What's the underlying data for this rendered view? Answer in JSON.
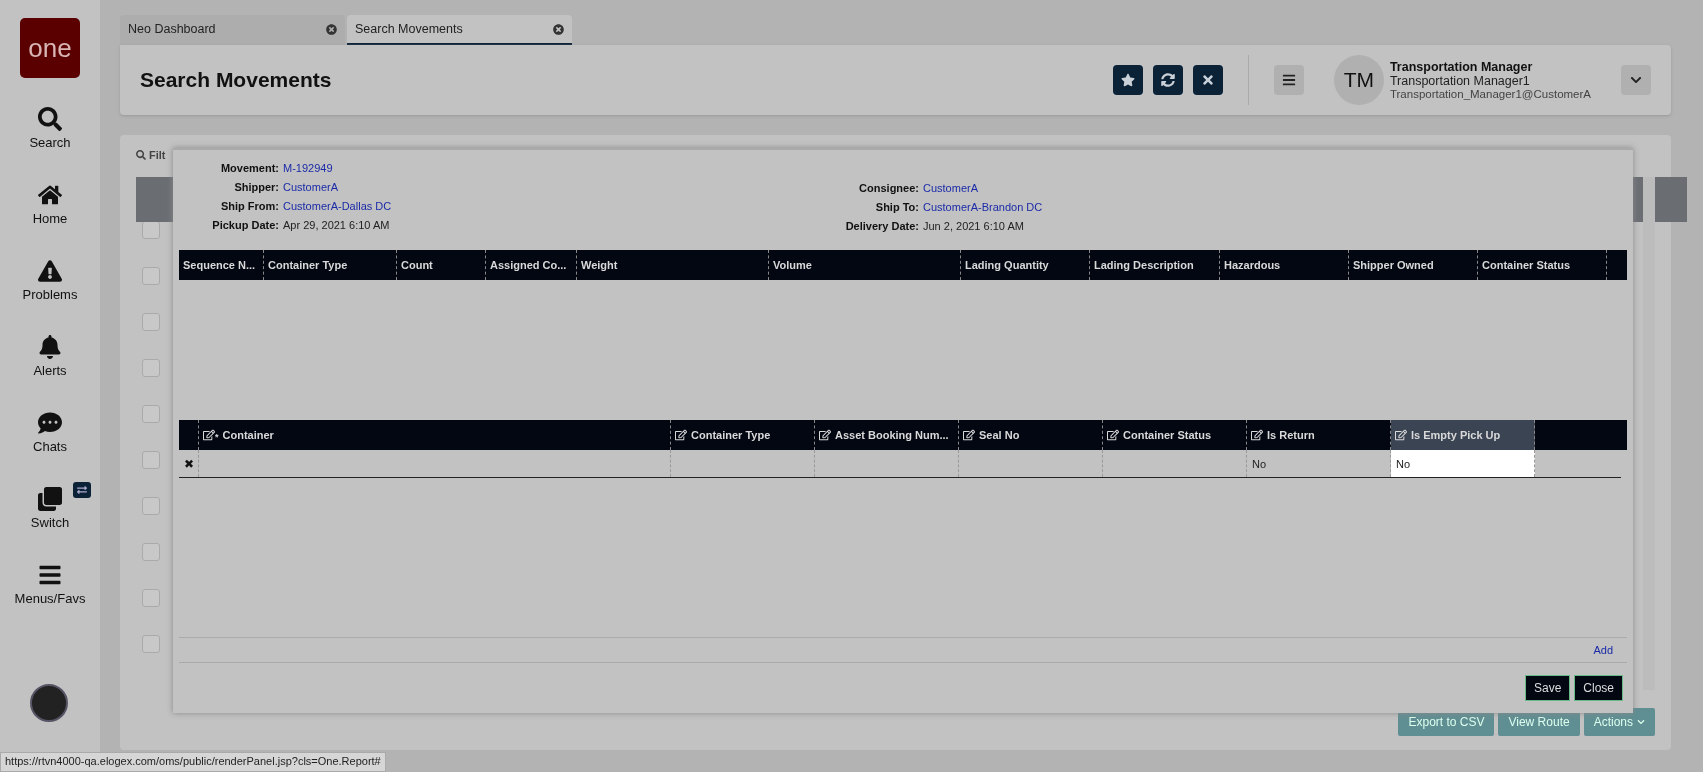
{
  "sidebar": {
    "logo": "one",
    "items": [
      {
        "label": "Search"
      },
      {
        "label": "Home"
      },
      {
        "label": "Problems"
      },
      {
        "label": "Alerts"
      },
      {
        "label": "Chats"
      },
      {
        "label": "Switch"
      },
      {
        "label": "Menus/Favs"
      }
    ]
  },
  "tabs": [
    {
      "label": "Neo Dashboard",
      "selected": false
    },
    {
      "label": "Search Movements",
      "selected": true
    }
  ],
  "header": {
    "title": "Search Movements",
    "user": {
      "initials": "TM",
      "name": "Transportation Manager",
      "role": "Transportation Manager1",
      "email": "Transportation_Manager1@CustomerA"
    }
  },
  "background": {
    "filter_label": "Filt",
    "rows": [
      {
        "checked": false
      },
      {
        "checked": false
      },
      {
        "checked": false
      },
      {
        "checked": false
      },
      {
        "checked": false
      },
      {
        "checked": false
      },
      {
        "checked": false
      },
      {
        "checked": false
      },
      {
        "checked": false
      },
      {
        "checked": false
      }
    ],
    "buttons": [
      "Export to CSV",
      "View Route",
      "Actions"
    ]
  },
  "modal": {
    "fields_left": [
      {
        "label": "Movement:",
        "value": "M-192949",
        "link": true
      },
      {
        "label": "Shipper:",
        "value": "CustomerA",
        "link": true
      },
      {
        "label": "Ship From:",
        "value": "CustomerA-Dallas DC",
        "link": true
      },
      {
        "label": "Pickup Date:",
        "value": "Apr 29, 2021 6:10 AM",
        "link": false
      }
    ],
    "fields_right": [
      {
        "label": "Consignee:",
        "value": "CustomerA",
        "link": true
      },
      {
        "label": "Ship To:",
        "value": "CustomerA-Brandon DC",
        "link": true
      },
      {
        "label": "Delivery Date:",
        "value": "Jun 2, 2021 6:10 AM",
        "link": false
      }
    ],
    "lading_table": {
      "columns": [
        "Sequence N...",
        "Container Type",
        "Count",
        "Assigned Co...",
        "Weight",
        "Volume",
        "Lading Quantity",
        "Lading Description",
        "Hazardous",
        "Shipper Owned",
        "Container Status"
      ]
    },
    "containers_table": {
      "columns": [
        {
          "label": "Container",
          "marker": "*",
          "highlighted": false
        },
        {
          "label": "Container Type",
          "highlighted": false
        },
        {
          "label": "Asset Booking Num...",
          "highlighted": false
        },
        {
          "label": "Seal No",
          "highlighted": false
        },
        {
          "label": "Container Status",
          "highlighted": false
        },
        {
          "label": "Is Return",
          "highlighted": false
        },
        {
          "label": "Is Empty Pick Up",
          "highlighted": true
        }
      ],
      "rows": [
        {
          "delete": "✖",
          "cells": [
            null,
            null,
            null,
            null,
            null,
            "No",
            "No"
          ]
        }
      ]
    },
    "add_link": "Add",
    "buttons": [
      "Save",
      "Close"
    ]
  },
  "status_bar": "https://rtvn4000-qa.elogex.com/oms/public/renderPanel.jsp?cls=One.Report#"
}
